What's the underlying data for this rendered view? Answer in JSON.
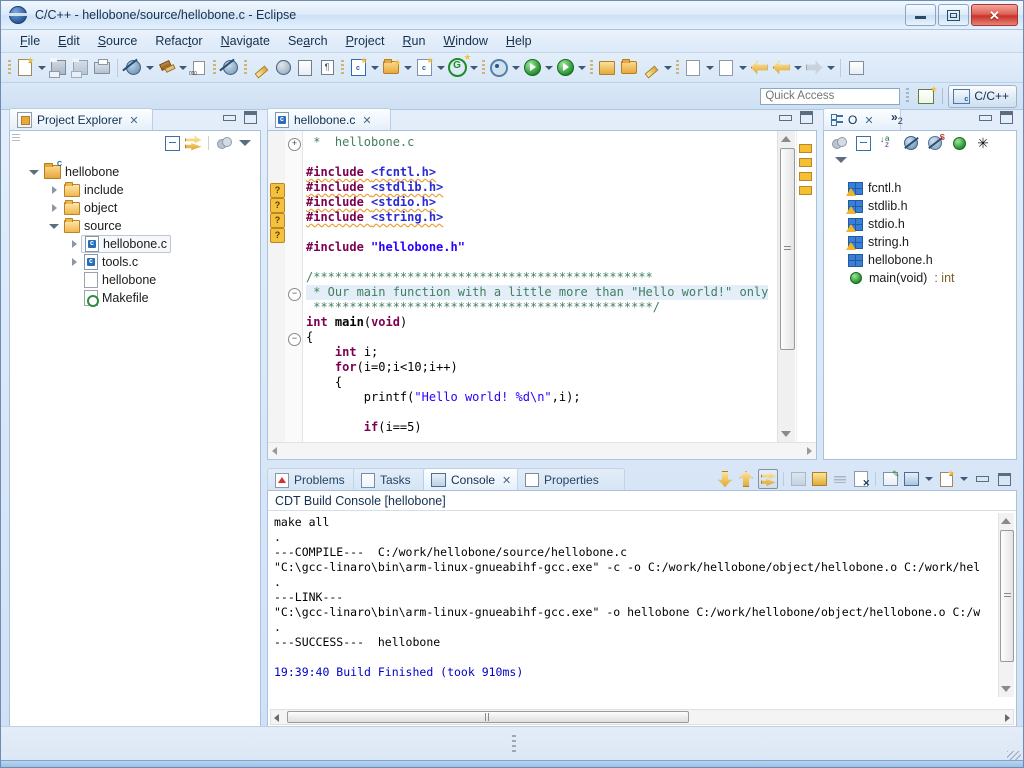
{
  "window": {
    "title": "C/C++ - hellobone/source/hellobone.c - Eclipse",
    "app_icon": "eclipse-icon",
    "minimize": "minimize-button",
    "maximize": "maximize-button",
    "close": "close-button"
  },
  "menu": {
    "items": [
      {
        "label": "File"
      },
      {
        "label": "Edit"
      },
      {
        "label": "Source"
      },
      {
        "label": "Refactor"
      },
      {
        "label": "Navigate"
      },
      {
        "label": "Search"
      },
      {
        "label": "Project"
      },
      {
        "label": "Run"
      },
      {
        "label": "Window"
      },
      {
        "label": "Help"
      }
    ]
  },
  "toolbar": {
    "buttons": [
      {
        "name": "new-wizard",
        "icon": "new-file-icon",
        "has_dropdown": true
      },
      {
        "name": "save",
        "icon": "save-icon",
        "has_dropdown": false
      },
      {
        "name": "save-all",
        "icon": "save-all-icon",
        "has_dropdown": false
      },
      {
        "name": "print",
        "icon": "print-icon",
        "has_dropdown": false
      },
      {
        "name": "build-all",
        "icon": "build-all-icon",
        "has_dropdown": true
      },
      {
        "name": "build",
        "icon": "hammer-icon",
        "has_dropdown": true
      },
      {
        "name": "open-hex-editor",
        "icon": "binary-icon",
        "has_dropdown": false
      },
      {
        "name": "skip-breakpoints",
        "icon": "skip-breakpoints-icon",
        "has_dropdown": false
      },
      {
        "name": "new-c-project",
        "icon": "pencil-icon",
        "has_dropdown": false
      },
      {
        "name": "debug-config",
        "icon": "bug-icon",
        "has_dropdown": false
      },
      {
        "name": "open-element",
        "icon": "list-icon",
        "has_dropdown": false
      },
      {
        "name": "toggle-mark",
        "icon": "pilcrow-icon",
        "has_dropdown": false
      },
      {
        "name": "new-c-class",
        "icon": "c-class-icon",
        "has_dropdown": true
      },
      {
        "name": "new-c-source",
        "icon": "c-source-icon",
        "has_dropdown": true
      },
      {
        "name": "new-c-header",
        "icon": "c-header-icon",
        "has_dropdown": true
      },
      {
        "name": "new-project-g",
        "icon": "g-new-icon",
        "has_dropdown": true
      },
      {
        "name": "debug",
        "icon": "debug-icon",
        "has_dropdown": true
      },
      {
        "name": "run",
        "icon": "run-icon",
        "has_dropdown": true
      },
      {
        "name": "run-external",
        "icon": "run-external-icon",
        "has_dropdown": true
      },
      {
        "name": "open-perspective",
        "icon": "open-folder-icon",
        "has_dropdown": false
      },
      {
        "name": "open-resource",
        "icon": "folder-icon",
        "has_dropdown": false
      },
      {
        "name": "search-marker",
        "icon": "marker-pen-icon",
        "has_dropdown": true
      },
      {
        "name": "next-annotation",
        "icon": "next-annotation-icon",
        "has_dropdown": true
      },
      {
        "name": "previous-annotation",
        "icon": "previous-annotation-icon",
        "has_dropdown": true
      },
      {
        "name": "back",
        "icon": "back-arrow-icon",
        "has_dropdown": false
      },
      {
        "name": "forward-back",
        "icon": "back-arrow-2-icon",
        "has_dropdown": true
      },
      {
        "name": "forward",
        "icon": "forward-arrow-icon",
        "has_dropdown": true
      },
      {
        "name": "pin-editor",
        "icon": "pin-editor-icon",
        "has_dropdown": false
      }
    ]
  },
  "quick_access": {
    "placeholder": "Quick Access",
    "value": "",
    "new_perspective_icon": "new-perspective-icon",
    "perspective": {
      "label": "C/C++",
      "icon": "cpp-perspective-icon"
    }
  },
  "project_explorer": {
    "tab_label": "Project Explorer",
    "tab_icon": "project-explorer-icon",
    "toolbar": [
      {
        "name": "collapse-all",
        "icon": "collapse-all-icon"
      },
      {
        "name": "link-with-editor",
        "icon": "link-editor-icon"
      },
      {
        "name": "view-menu-filters",
        "icon": "filters-icon"
      },
      {
        "name": "view-menu",
        "icon": "chevron-down-icon"
      }
    ],
    "tree": [
      {
        "label": "hellobone",
        "indent": 0,
        "icon": "c-project-icon",
        "twist": "open",
        "selected": false
      },
      {
        "label": "include",
        "indent": 1,
        "icon": "folder-icon",
        "twist": "closed",
        "selected": false
      },
      {
        "label": "object",
        "indent": 1,
        "icon": "folder-icon",
        "twist": "closed",
        "selected": false
      },
      {
        "label": "source",
        "indent": 1,
        "icon": "folder-icon",
        "twist": "open",
        "selected": false
      },
      {
        "label": "hellobone.c",
        "indent": 2,
        "icon": "c-file-icon",
        "twist": "closed",
        "selected": true
      },
      {
        "label": "tools.c",
        "indent": 2,
        "icon": "c-file-icon",
        "twist": "closed",
        "selected": false
      },
      {
        "label": "hellobone",
        "indent": 2,
        "icon": "binary-file-icon",
        "twist": "none",
        "selected": false
      },
      {
        "label": "Makefile",
        "indent": 2,
        "icon": "makefile-icon",
        "twist": "none",
        "selected": false
      }
    ]
  },
  "editor": {
    "tab_label": "hellobone.c",
    "tab_icon": "c-file-icon",
    "close_icon": "close-tab-icon",
    "minimize_icon": "minimize-icon",
    "maximize_icon": "maximize-icon",
    "warning_marker_count": 4,
    "ruler_markers": 4,
    "lines": [
      {
        "n": 1,
        "text": " *  hellobone.c",
        "kind": "comment",
        "fold": "plus",
        "marker": "none"
      },
      {
        "n": 2,
        "text": "",
        "kind": "plain",
        "fold": "none",
        "marker": "none"
      },
      {
        "n": 3,
        "text": "#include <fcntl.h>",
        "kind": "include",
        "fold": "none",
        "marker": "warning"
      },
      {
        "n": 4,
        "text": "#include <stdlib.h>",
        "kind": "include",
        "fold": "none",
        "marker": "warning"
      },
      {
        "n": 5,
        "text": "#include <stdio.h>",
        "kind": "include",
        "fold": "none",
        "marker": "warning"
      },
      {
        "n": 6,
        "text": "#include <string.h>",
        "kind": "include",
        "fold": "none",
        "marker": "warning"
      },
      {
        "n": 7,
        "text": "",
        "kind": "plain",
        "fold": "none",
        "marker": "none"
      },
      {
        "n": 8,
        "text": "#include \"hellobone.h\"",
        "kind": "include-q",
        "fold": "none",
        "marker": "none"
      },
      {
        "n": 9,
        "text": "",
        "kind": "plain",
        "fold": "none",
        "marker": "none"
      }
    ],
    "code": {
      "comment_open": "/***********************************************",
      "comment_body": " * Our main function with a little more than \"Hello world!\" only",
      "comment_close": " ***********************************************/",
      "fn_signature": "int main(void)",
      "brace_open": "{",
      "decl_i": "    int i;",
      "for_stmt": "    for(i=0;i<10;i++)",
      "inner_brace": "    {",
      "printf_stmt": "        printf(\"Hello world! %d\\n\",i);",
      "if_stmt": "        if(i==5)"
    }
  },
  "outline": {
    "tab_label": "O",
    "tab_icon": "outline-icon",
    "overflow_label": "2",
    "toolbar": [
      {
        "name": "focus-on-active-task",
        "icon": "focus-task-icon"
      },
      {
        "name": "collapse-all",
        "icon": "collapse-all-icon"
      },
      {
        "name": "sort",
        "icon": "sort-az-icon"
      },
      {
        "name": "hide-fields",
        "icon": "hide-fields-icon"
      },
      {
        "name": "hide-static",
        "icon": "hide-static-icon"
      },
      {
        "name": "hide-non-public",
        "icon": "hide-nonpublic-icon"
      },
      {
        "name": "hide-macros",
        "icon": "hide-macros-icon"
      },
      {
        "name": "view-menu",
        "icon": "chevron-down-icon"
      }
    ],
    "items": [
      {
        "label": "fcntl.h",
        "icon": "include-icon",
        "warning": true,
        "type": ""
      },
      {
        "label": "stdlib.h",
        "icon": "include-icon",
        "warning": true,
        "type": ""
      },
      {
        "label": "stdio.h",
        "icon": "include-icon",
        "warning": true,
        "type": ""
      },
      {
        "label": "string.h",
        "icon": "include-icon",
        "warning": true,
        "type": ""
      },
      {
        "label": "hellobone.h",
        "icon": "include-icon",
        "warning": false,
        "type": ""
      },
      {
        "label": "main(void)",
        "icon": "function-icon",
        "warning": false,
        "type": " : int"
      }
    ]
  },
  "bottom_panel": {
    "tabs": [
      {
        "label": "Problems",
        "icon": "problems-icon",
        "active": false,
        "closable": false
      },
      {
        "label": "Tasks",
        "icon": "tasks-icon",
        "active": false,
        "closable": false
      },
      {
        "label": "Console",
        "icon": "console-icon",
        "active": true,
        "closable": true
      },
      {
        "label": "Properties",
        "icon": "properties-icon",
        "active": false,
        "closable": false
      }
    ],
    "toolbar": [
      {
        "name": "scroll-down",
        "icon": "arrow-down-icon",
        "active": false
      },
      {
        "name": "scroll-up",
        "icon": "arrow-up-icon",
        "active": false
      },
      {
        "name": "scroll-lock",
        "icon": "scroll-lock-icon",
        "active": true
      },
      {
        "name": "save-console",
        "icon": "save-console-icon",
        "active": false
      },
      {
        "name": "lock-console",
        "icon": "lock-icon",
        "active": false
      },
      {
        "name": "clear-console",
        "icon": "clear-console-icon",
        "active": false
      },
      {
        "name": "remove-console",
        "icon": "remove-console-icon",
        "active": false
      },
      {
        "name": "pin-console",
        "icon": "pin-console-icon",
        "active": false
      },
      {
        "name": "display-selected-console",
        "icon": "display-console-icon",
        "active": false,
        "has_dropdown": true
      },
      {
        "name": "open-console",
        "icon": "open-console-icon",
        "active": false,
        "has_dropdown": true
      },
      {
        "name": "minimize",
        "icon": "minimize-icon",
        "active": false
      },
      {
        "name": "maximize",
        "icon": "maximize-icon",
        "active": false
      }
    ],
    "console": {
      "title": "CDT Build Console [hellobone]",
      "lines": [
        {
          "text": "make all",
          "color": "black"
        },
        {
          "text": ".",
          "color": "black"
        },
        {
          "text": "---COMPILE---  C:/work/hellobone/source/hellobone.c",
          "color": "black"
        },
        {
          "text": "\"C:\\gcc-linaro\\bin\\arm-linux-gnueabihf-gcc.exe\" -c -o C:/work/hellobone/object/hellobone.o C:/work/hel",
          "color": "black"
        },
        {
          "text": ".",
          "color": "black"
        },
        {
          "text": "---LINK---",
          "color": "black"
        },
        {
          "text": "\"C:\\gcc-linaro\\bin\\arm-linux-gnueabihf-gcc.exe\" -o hellobone C:/work/hellobone/object/hellobone.o C:/w",
          "color": "black"
        },
        {
          "text": ".",
          "color": "black"
        },
        {
          "text": "---SUCCESS---  hellobone",
          "color": "black"
        },
        {
          "text": "",
          "color": "black"
        },
        {
          "text": "19:39:40 Build Finished (took 910ms)",
          "color": "blue"
        }
      ]
    }
  },
  "status_bar": {
    "text": "",
    "grip": "panel-resize-grip",
    "resize": "window-resize-grip"
  },
  "colors": {
    "accent": "#2b6cb8",
    "warning": "#f5c13a",
    "success": "#1f8c2b",
    "console_blue": "#0000c8",
    "keyword": "#7b0052",
    "string": "#2a00ff",
    "comment": "#3f7f5f",
    "header": "#2b2bd6"
  }
}
